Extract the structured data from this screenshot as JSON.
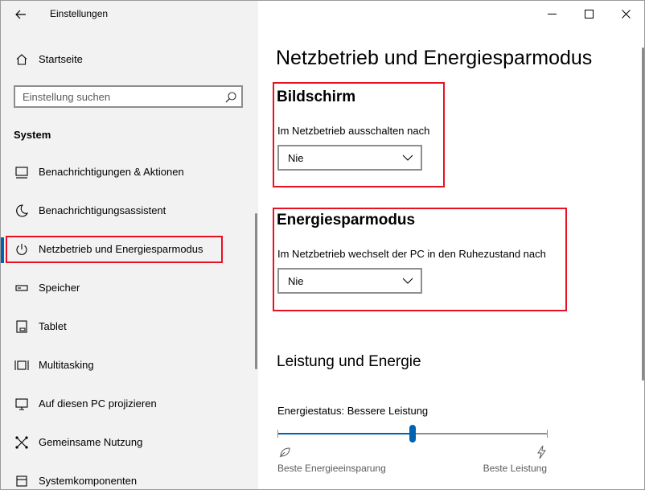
{
  "window": {
    "title": "Einstellungen"
  },
  "sidebar": {
    "home_label": "Startseite",
    "search": {
      "placeholder": "Einstellung suchen",
      "value": ""
    },
    "section_label": "System",
    "items": [
      {
        "label": "Benachrichtigungen & Aktionen",
        "icon": "notification-icon"
      },
      {
        "label": "Benachrichtigungsassistent",
        "icon": "moon-icon"
      },
      {
        "label": "Netzbetrieb und Energiesparmodus",
        "icon": "power-icon",
        "selected": true
      },
      {
        "label": "Speicher",
        "icon": "storage-icon"
      },
      {
        "label": "Tablet",
        "icon": "tablet-icon"
      },
      {
        "label": "Multitasking",
        "icon": "multitasking-icon"
      },
      {
        "label": "Auf diesen PC projizieren",
        "icon": "project-icon"
      },
      {
        "label": "Gemeinsame Nutzung",
        "icon": "share-icon"
      },
      {
        "label": "Systemkomponenten",
        "icon": "components-icon"
      }
    ]
  },
  "main": {
    "page_title": "Netzbetrieb und Energiesparmodus",
    "screen": {
      "heading": "Bildschirm",
      "label": "Im Netzbetrieb ausschalten nach",
      "value": "Nie"
    },
    "sleep": {
      "heading": "Energiesparmodus",
      "label": "Im Netzbetrieb wechselt der PC in den Ruhezustand nach",
      "value": "Nie"
    },
    "performance": {
      "heading": "Leistung und Energie",
      "status_label": "Energiestatus: Bessere Leistung",
      "slider_fraction": 0.5,
      "left_label": "Beste Energieeinsparung",
      "right_label": "Beste Leistung"
    }
  },
  "colors": {
    "accent": "#0063b1",
    "highlight": "#e81123",
    "sidebar_bg": "#f2f2f2"
  }
}
